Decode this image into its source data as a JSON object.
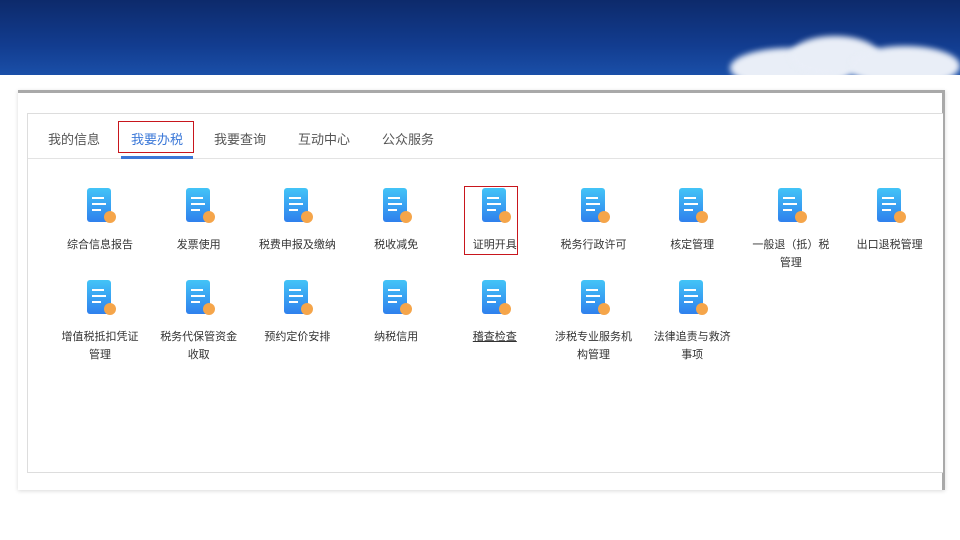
{
  "tabs": [
    {
      "label": "我的信息"
    },
    {
      "label": "我要办税",
      "active": true
    },
    {
      "label": "我要查询"
    },
    {
      "label": "互动中心"
    },
    {
      "label": "公众服务"
    }
  ],
  "items": [
    {
      "label": "综合信息报告",
      "icon": "clipboard-mic-icon"
    },
    {
      "label": "发票使用",
      "icon": "invoice-icon"
    },
    {
      "label": "税费申报及缴纳",
      "icon": "tax-payment-icon"
    },
    {
      "label": "税收减免",
      "icon": "tax-reduction-icon"
    },
    {
      "label": "证明开具",
      "icon": "certificate-folder-icon"
    },
    {
      "label": "税务行政许可",
      "icon": "license-icon"
    },
    {
      "label": "核定管理",
      "icon": "assessment-icon"
    },
    {
      "label": "一般退（抵）税管理",
      "icon": "refund-gear-icon"
    },
    {
      "label": "出口退税管理",
      "icon": "export-refund-icon"
    },
    {
      "label": "增值税抵扣凭证管理",
      "icon": "vat-voucher-icon"
    },
    {
      "label": "税务代保管资金收取",
      "icon": "custody-funds-icon"
    },
    {
      "label": "预约定价安排",
      "icon": "calendar-check-icon"
    },
    {
      "label": "纳税信用",
      "icon": "credit-shield-icon"
    },
    {
      "label": "稽查检查",
      "icon": "inspection-shield-icon"
    },
    {
      "label": "涉税专业服务机构管理",
      "icon": "institution-icon"
    },
    {
      "label": "法律追责与救济事项",
      "icon": "law-book-icon"
    }
  ],
  "colors": {
    "accent": "#3b78d8",
    "highlight": "#c8161d",
    "icon_blue": "#3aa0f0",
    "icon_orange": "#f5a54a"
  }
}
